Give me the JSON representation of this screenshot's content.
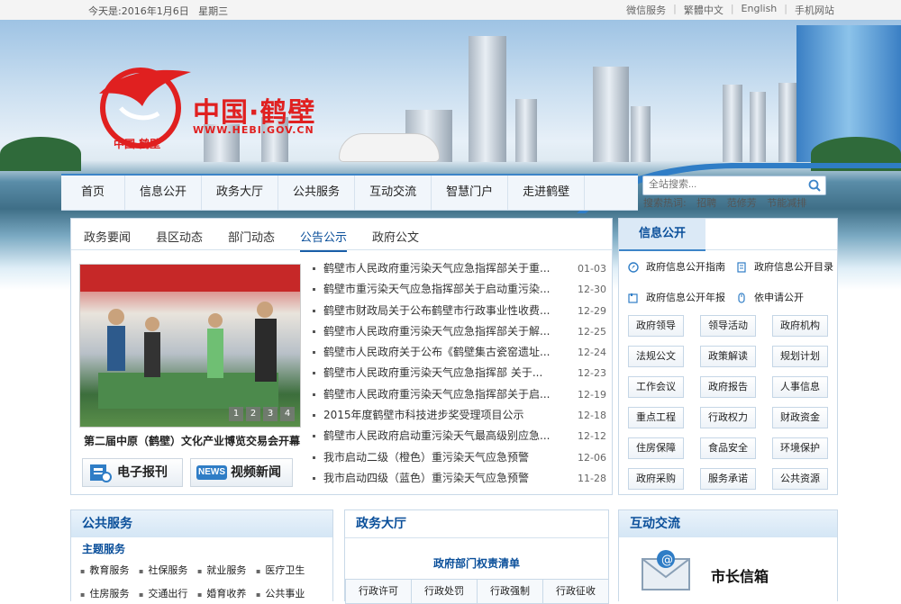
{
  "topbar": {
    "date_label": "今天是:2016年1月6日   星期三",
    "links": [
      "微信服务",
      "繁體中文",
      "English",
      "手机网站"
    ]
  },
  "logo": {
    "name": "中国·鹤壁",
    "url": "WWW.HEBI.GOV.CN",
    "emblem_text": "中国 鹤壁",
    "color": "#e02020"
  },
  "nav": {
    "items": [
      "首页",
      "信息公开",
      "政务大厅",
      "公共服务",
      "互动交流",
      "智慧门户",
      "走进鹤壁"
    ]
  },
  "search": {
    "placeholder": "全站搜索...",
    "hot_label": "搜索热词:",
    "hot_words": [
      "招聘",
      "范修芳",
      "节能减排"
    ]
  },
  "news": {
    "tabs": [
      "政务要闻",
      "县区动态",
      "部门动态",
      "公告公示",
      "政府公文"
    ],
    "active_tab": "公告公示",
    "photo_caption": "第二届中原（鹤壁）文化产业博览交易会开幕",
    "carousel_pages": [
      "1",
      "2",
      "3",
      "4"
    ],
    "buttons": {
      "epaper": "电子报刊",
      "video_badge": "NEWS",
      "video": "视频新闻"
    },
    "items": [
      {
        "title": "鹤壁市人民政府重污染天气应急指挥部关于重...",
        "date": "01-03"
      },
      {
        "title": "鹤壁市重污染天气应急指挥部关于启动重污染...",
        "date": "12-30"
      },
      {
        "title": "鹤壁市财政局关于公布鹤壁市行政事业性收费...",
        "date": "12-29"
      },
      {
        "title": "鹤壁市人民政府重污染天气应急指挥部关于解...",
        "date": "12-25"
      },
      {
        "title": "鹤壁市人民政府关于公布《鹤壁集古瓷窑遗址...",
        "date": "12-24"
      },
      {
        "title": "鹤壁市人民政府重污染天气应急指挥部 关于...",
        "date": "12-23"
      },
      {
        "title": "鹤壁市人民政府重污染天气应急指挥部关于启...",
        "date": "12-19"
      },
      {
        "title": "2015年度鹤壁市科技进步奖受理项目公示",
        "date": "12-18"
      },
      {
        "title": "鹤壁市人民政府启动重污染天气最高级别应急...",
        "date": "12-12"
      },
      {
        "title": "我市启动二级（橙色）重污染天气应急预警",
        "date": "12-06"
      },
      {
        "title": "我市启动四级（蓝色）重污染天气应急预警",
        "date": "11-28"
      }
    ]
  },
  "info": {
    "title": "信息公开",
    "links": [
      "政府信息公开指南",
      "政府信息公开目录",
      "政府信息公开年报",
      "依申请公开"
    ],
    "grid": [
      "政府领导",
      "领导活动",
      "政府机构",
      "法规公文",
      "政策解读",
      "规划计划",
      "工作会议",
      "政府报告",
      "人事信息",
      "重点工程",
      "行政权力",
      "财政资金",
      "住房保障",
      "食品安全",
      "环境保护",
      "政府采购",
      "服务承诺",
      "公共资源"
    ]
  },
  "public_service": {
    "title": "公共服务",
    "subtitle": "主题服务",
    "items": [
      "教育服务",
      "社保服务",
      "就业服务",
      "医疗卫生",
      "住房服务",
      "交通出行",
      "婚育收养",
      "公共事业"
    ]
  },
  "gov_hall": {
    "title": "政务大厅",
    "list_title": "政府部门权责清单",
    "cells": [
      "行政许可",
      "行政处罚",
      "行政强制",
      "行政征收"
    ]
  },
  "interaction": {
    "title": "互动交流",
    "mailbox": "市长信箱"
  }
}
